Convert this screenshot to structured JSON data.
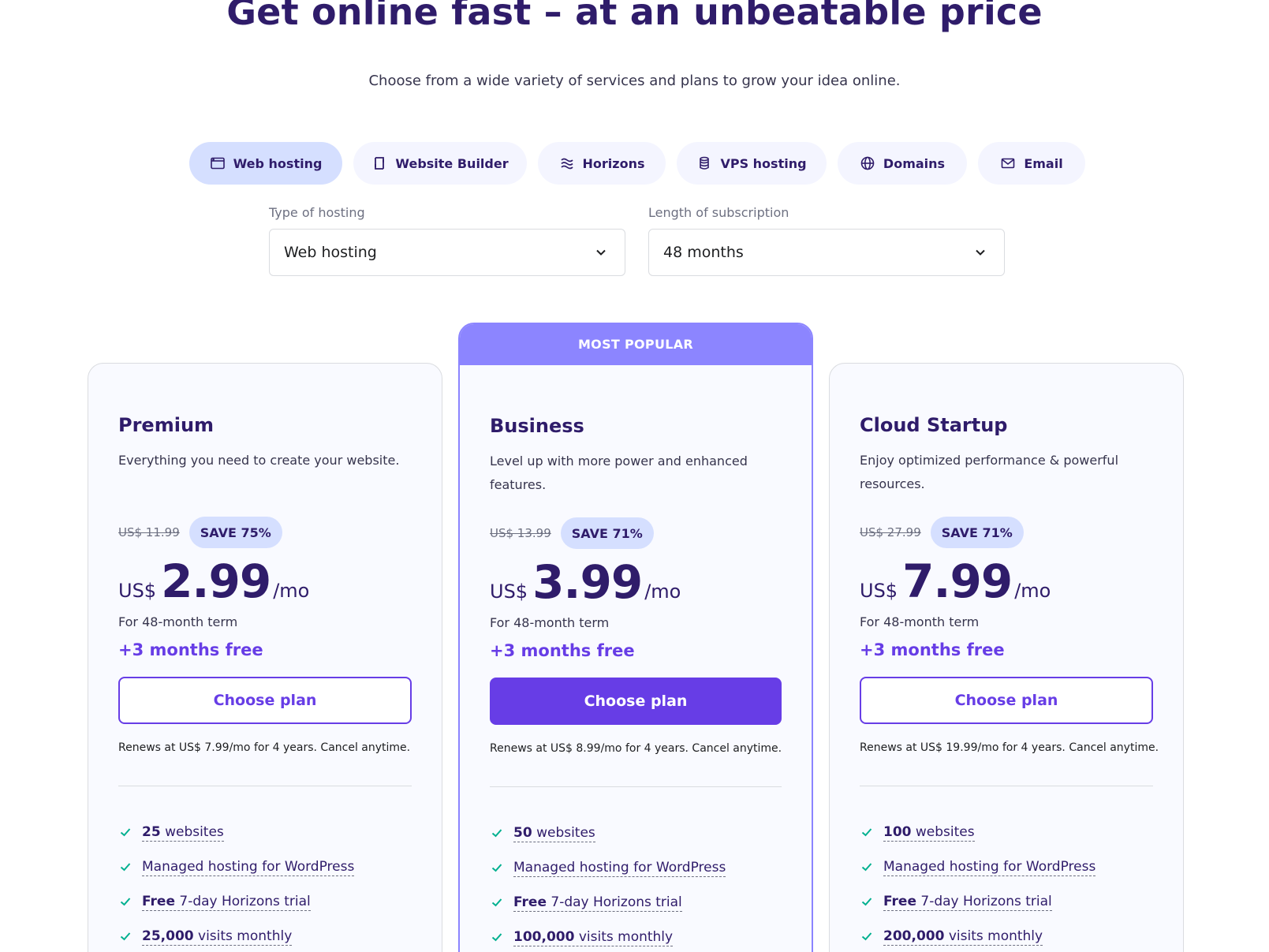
{
  "hero": {
    "title": "Get online fast – at an unbeatable price",
    "subtitle": "Choose from a wide variety of services and plans to grow your idea online."
  },
  "tabs": [
    {
      "label": "Web hosting",
      "icon": "browser-window-icon",
      "active": true
    },
    {
      "label": "Website Builder",
      "icon": "builder-icon",
      "active": false
    },
    {
      "label": "Horizons",
      "icon": "horizons-icon",
      "active": false
    },
    {
      "label": "VPS hosting",
      "icon": "database-icon",
      "active": false
    },
    {
      "label": "Domains",
      "icon": "globe-icon",
      "active": false
    },
    {
      "label": "Email",
      "icon": "envelope-icon",
      "active": false
    }
  ],
  "filters": {
    "type": {
      "label": "Type of hosting",
      "value": "Web hosting"
    },
    "length": {
      "label": "Length of subscription",
      "value": "48 months"
    }
  },
  "colors": {
    "brand": "#673de6",
    "heading": "#2f1c6a",
    "popular_banner": "#8c85ff",
    "badge": "#d5dfff",
    "check": "#00b090"
  },
  "plans": [
    {
      "name": "Premium",
      "description": "Everything you need to create your website.",
      "old_price": "US$ 11.99",
      "save": "SAVE 75%",
      "currency": "US$",
      "price": "2.99",
      "per": "/mo",
      "term": "For 48-month term",
      "bonus": "+3 months free",
      "cta": "Choose plan",
      "renews": "Renews at US$ 7.99/mo for 4 years. Cancel anytime.",
      "features": [
        {
          "bold": "25",
          "text": "websites"
        },
        {
          "bold": "",
          "text": "Managed hosting for WordPress"
        },
        {
          "bold": "Free",
          "text": "7-day Horizons trial"
        },
        {
          "bold": "25,000",
          "text": "visits monthly"
        }
      ]
    },
    {
      "name": "Business",
      "badge": "MOST POPULAR",
      "description": "Level up with more power and enhanced features.",
      "old_price": "US$ 13.99",
      "save": "SAVE 71%",
      "currency": "US$",
      "price": "3.99",
      "per": "/mo",
      "term": "For 48-month term",
      "bonus": "+3 months free",
      "cta": "Choose plan",
      "renews": "Renews at US$ 8.99/mo for 4 years. Cancel anytime.",
      "features": [
        {
          "bold": "50",
          "text": "websites"
        },
        {
          "bold": "",
          "text": "Managed hosting for WordPress"
        },
        {
          "bold": "Free",
          "text": "7-day Horizons trial"
        },
        {
          "bold": "100,000",
          "text": "visits monthly"
        }
      ]
    },
    {
      "name": "Cloud Startup",
      "description": "Enjoy optimized performance & powerful resources.",
      "old_price": "US$ 27.99",
      "save": "SAVE 71%",
      "currency": "US$",
      "price": "7.99",
      "per": "/mo",
      "term": "For 48-month term",
      "bonus": "+3 months free",
      "cta": "Choose plan",
      "renews": "Renews at US$ 19.99/mo for 4 years. Cancel anytime.",
      "features": [
        {
          "bold": "100",
          "text": "websites"
        },
        {
          "bold": "",
          "text": "Managed hosting for WordPress"
        },
        {
          "bold": "Free",
          "text": "7-day Horizons trial"
        },
        {
          "bold": "200,000",
          "text": "visits monthly"
        }
      ]
    }
  ]
}
